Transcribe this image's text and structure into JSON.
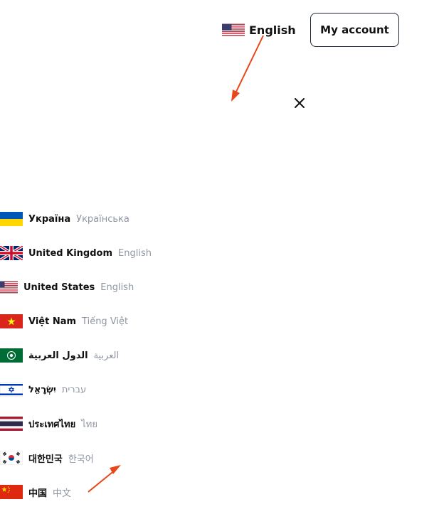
{
  "header": {
    "current_language": "English",
    "account_label": "My account"
  },
  "languages": [
    {
      "country": "Україна",
      "language": "Українська",
      "flag": "ua-flag"
    },
    {
      "country": "United Kingdom",
      "language": "English",
      "flag": "gb-flag"
    },
    {
      "country": "United States",
      "language": "English",
      "flag": "us-flag"
    },
    {
      "country": "Việt Nam",
      "language": "Tiếng Việt",
      "flag": "vn-flag"
    },
    {
      "country": "الدول العربية",
      "language": "العربية",
      "flag": "arab-league-flag"
    },
    {
      "country": "יִשְׂרָאֵל",
      "language": "עברית",
      "flag": "il-flag"
    },
    {
      "country": "ประเทศไทย",
      "language": "ไทย",
      "flag": "th-flag"
    },
    {
      "country": "대한민국",
      "language": "한국어",
      "flag": "kr-flag"
    },
    {
      "country": "中国",
      "language": "中文",
      "flag": "cn-flag"
    }
  ],
  "icons": {
    "close": "close-icon",
    "annotation": "arrow-annotation"
  },
  "colors": {
    "annotation_arrow": "#e8471c",
    "secondary_text": "#8f96a3"
  }
}
